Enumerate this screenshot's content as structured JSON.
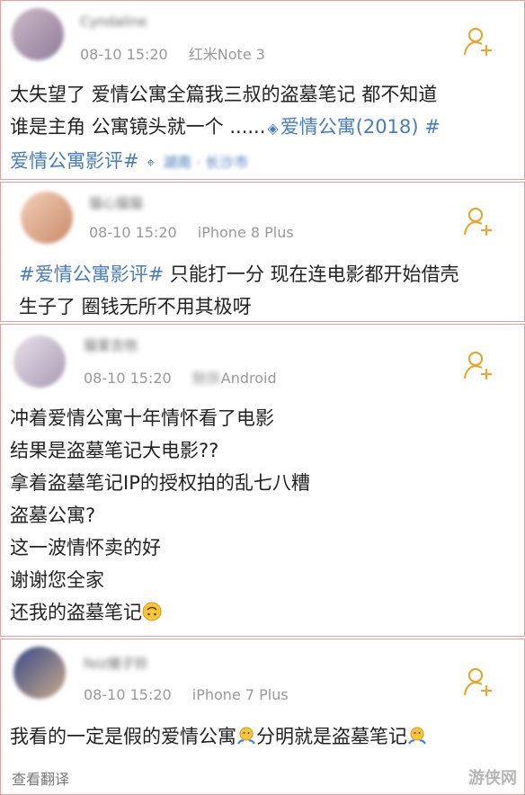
{
  "posts": [
    {
      "time": "08-10 15:20",
      "device": "红米Note 3",
      "username": "Cyndaline",
      "lines": [
        "太失望了 爱情公寓全篇我三叔的盗墓笔记 都不知道",
        "谁是主角 公寓镜头就一个 ......"
      ],
      "topic1": "爱情公寓(2018) #",
      "topic2": "爱情公寓影评#",
      "location": "湖南 · 长沙市"
    },
    {
      "time": "08-10 15:20",
      "device": "iPhone 8 Plus",
      "username": "猫心猫猫",
      "topic": "#爱情公寓影评#",
      "line1": " 只能打一分 现在连电影都开始借壳",
      "line2": "生子了 圈钱无所不用其极呀"
    },
    {
      "time": "08-10 15:20",
      "device": "Android",
      "device_prefix": "魅族",
      "username": "猫爱吉他",
      "lines": [
        "冲着爱情公寓十年情怀看了电影",
        "结果是盗墓笔记大电影??",
        "拿着盗墓笔记IP的授权拍的乱七八糟",
        "盗墓公寓?",
        "这一波情怀卖的好",
        "谢谢您全家"
      ],
      "last_line": "还我的盗墓笔记"
    },
    {
      "time": "08-10 15:20",
      "device": "iPhone 7 Plus",
      "username": "feiz猪子铃",
      "text1": "我看的一定是假的爱情公寓",
      "text2": "分明就是盗墓笔记",
      "translate": "查看翻译"
    }
  ],
  "watermark": "游侠网",
  "colors": {
    "topic": "#4b7cba",
    "follow": "#e0a93a",
    "border": "#e0a0a0"
  }
}
